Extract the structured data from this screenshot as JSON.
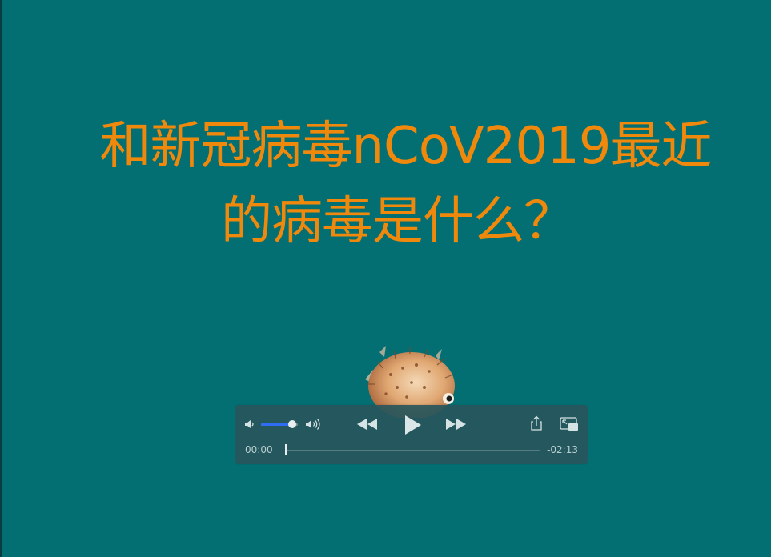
{
  "slide": {
    "title_line1": "和新冠病毒nCoV2019最近",
    "title_line2": "的病毒是什么？",
    "title_color": "#f0880c",
    "background": "#036f73"
  },
  "player": {
    "current_time": "00:00",
    "remaining_time": "-02:13",
    "volume_level": 0.85,
    "progress": 0.0,
    "accent_color": "#2f6df2",
    "icons": {
      "volume_low": "speaker-low-icon",
      "volume_high": "speaker-high-icon",
      "rewind": "rewind-icon",
      "play": "play-icon",
      "fast_forward": "fast-forward-icon",
      "share": "share-icon",
      "pip": "picture-in-picture-icon"
    }
  }
}
